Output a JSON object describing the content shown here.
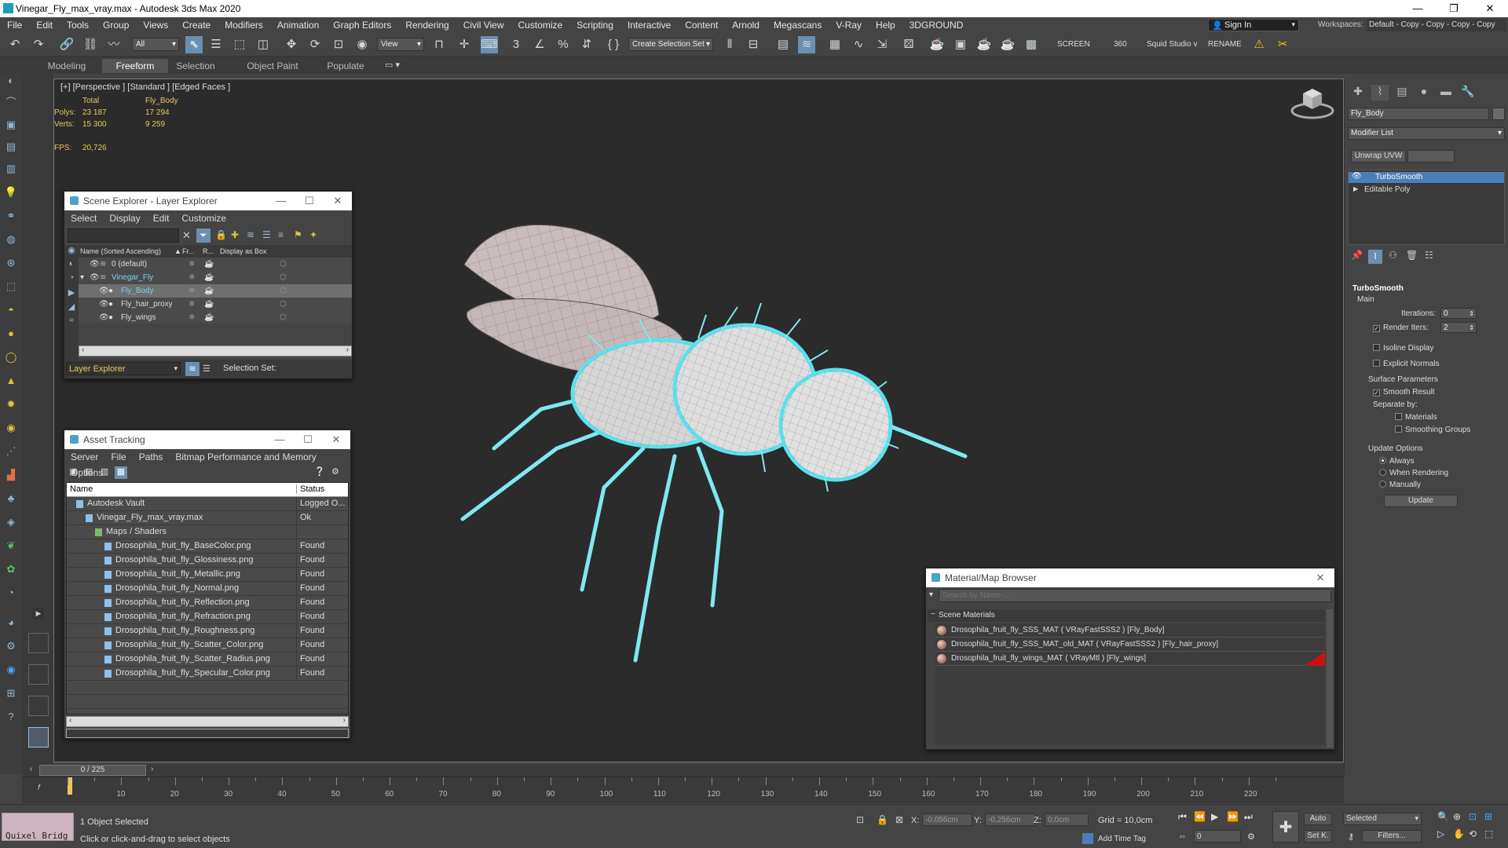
{
  "title_bar": {
    "title": "Vinegar_Fly_max_vray.max - Autodesk 3ds Max 2020"
  },
  "menu": [
    "File",
    "Edit",
    "Tools",
    "Group",
    "Views",
    "Create",
    "Modifiers",
    "Animation",
    "Graph Editors",
    "Rendering",
    "Civil View",
    "Customize",
    "Scripting",
    "Interactive",
    "Content",
    "Arnold",
    "Megascans",
    "V-Ray",
    "Help",
    "3DGROUND"
  ],
  "signin": {
    "label": "Sign In",
    "workspaces_label": "Workspaces:",
    "workspace_value": "Default - Copy - Copy - Copy - Copy"
  },
  "toolbar": {
    "filter_value": "All",
    "view_value": "View",
    "selection_set_value": "Create Selection Set",
    "screen_label": "SCREEN",
    "angle_value": "360",
    "squid_label": "Squid Studio v",
    "rename_label": "RENAME"
  },
  "ribbon": {
    "tabs": [
      "Modeling",
      "Freeform",
      "Selection",
      "Object Paint",
      "Populate"
    ],
    "active": "Freeform"
  },
  "viewport": {
    "label": "[+] [Perspective ] [Standard ] [Edged Faces ]",
    "stats": {
      "total_header": "Total",
      "object_header": "Fly_Body",
      "polys_label": "Polys:",
      "polys_total": "23 187",
      "polys_obj": "17 294",
      "verts_label": "Verts:",
      "verts_total": "15 300",
      "verts_obj": "9 259",
      "fps_label": "FPS:",
      "fps_value": "20,726"
    }
  },
  "scene_explorer": {
    "title": "Scene Explorer - Layer Explorer",
    "menu": [
      "Select",
      "Display",
      "Edit",
      "Customize"
    ],
    "headers": {
      "name": "Name (Sorted Ascending)",
      "sort": "▲",
      "frozen": "Fr...",
      "render": "R...",
      "display_box": "Display as Box"
    },
    "rows": [
      {
        "name": "0 (default)"
      },
      {
        "name": "Vinegar_Fly"
      },
      {
        "name": "Fly_Body"
      },
      {
        "name": "Fly_hair_proxy"
      },
      {
        "name": "Fly_wings"
      }
    ],
    "footer_explorer": "Layer Explorer",
    "footer_selection": "Selection Set:"
  },
  "asset_tracking": {
    "title": "Asset Tracking",
    "menu": [
      "Server",
      "File",
      "Paths",
      "Bitmap Performance and Memory",
      "Options"
    ],
    "columns": {
      "name": "Name",
      "status": "Status"
    },
    "rows": [
      {
        "name": "Autodesk Vault",
        "status": "Logged O..."
      },
      {
        "name": "Vinegar_Fly_max_vray.max",
        "status": "Ok"
      },
      {
        "name": "Maps / Shaders",
        "status": ""
      },
      {
        "name": "Drosophila_fruit_fly_BaseColor.png",
        "status": "Found"
      },
      {
        "name": "Drosophila_fruit_fly_Glossiness.png",
        "status": "Found"
      },
      {
        "name": "Drosophila_fruit_fly_Metallic.png",
        "status": "Found"
      },
      {
        "name": "Drosophila_fruit_fly_Normal.png",
        "status": "Found"
      },
      {
        "name": "Drosophila_fruit_fly_Reflection.png",
        "status": "Found"
      },
      {
        "name": "Drosophila_fruit_fly_Refraction.png",
        "status": "Found"
      },
      {
        "name": "Drosophila_fruit_fly_Roughness.png",
        "status": "Found"
      },
      {
        "name": "Drosophila_fruit_fly_Scatter_Color.png",
        "status": "Found"
      },
      {
        "name": "Drosophila_fruit_fly_Scatter_Radius.png",
        "status": "Found"
      },
      {
        "name": "Drosophila_fruit_fly_Specular_Color.png",
        "status": "Found"
      }
    ]
  },
  "material_browser": {
    "title": "Material/Map Browser",
    "search_placeholder": "Search by Name ...",
    "section": "Scene Materials",
    "materials": [
      "Drosophila_fruit_fly_SSS_MAT  ( VRayFastSSS2 )  [Fly_Body]",
      "Drosophila_fruit_fly_SSS_MAT_old_MAT  ( VRayFastSSS2 )  [Fly_hair_proxy]",
      "Drosophila_fruit_fly_wings_MAT  ( VRayMtl )  [Fly_wings]"
    ]
  },
  "command_panel": {
    "object_name": "Fly_Body",
    "modifier_list": "Modifier List",
    "unwrap_btn": "Unwrap UVW",
    "stack": [
      "TurboSmooth",
      "Editable Poly"
    ],
    "rollout_title": "TurboSmooth",
    "main_label": "Main",
    "iterations_label": "Iterations:",
    "iterations_value": "0",
    "render_iters_label": "Render Iters:",
    "render_iters_value": "2",
    "isoline_label": "Isoline Display",
    "explicit_label": "Explicit Normals",
    "surface_label": "Surface Parameters",
    "smooth_label": "Smooth Result",
    "separate_label": "Separate by:",
    "materials_label": "Materials",
    "smoothing_label": "Smoothing Groups",
    "update_label": "Update Options",
    "always_label": "Always",
    "when_rendering_label": "When Rendering",
    "manually_label": "Manually",
    "update_btn": "Update"
  },
  "timeline": {
    "frame_counter": "0 / 225",
    "ticks": [
      "10",
      "20",
      "30",
      "40",
      "50",
      "60",
      "70",
      "80",
      "90",
      "100",
      "110",
      "120",
      "130",
      "140",
      "150",
      "160",
      "170",
      "180",
      "190",
      "200",
      "210",
      "220"
    ]
  },
  "status": {
    "quixel_label": "Quixel Bridg",
    "selected_text": "1 Object Selected",
    "prompt_text": "Click or click-and-drag to select objects",
    "x_label": "X:",
    "x_value": "-0,056cm",
    "y_label": "Y:",
    "y_value": "-0,256cm",
    "z_label": "Z:",
    "z_value": "0,0cm",
    "grid_text": "Grid = 10,0cm",
    "add_time_tag": "Add Time Tag",
    "auto_label": "Auto",
    "selected_dropdown": "Selected",
    "set_key": "Set K.",
    "filters": "Filters...",
    "frame_value": "0"
  }
}
